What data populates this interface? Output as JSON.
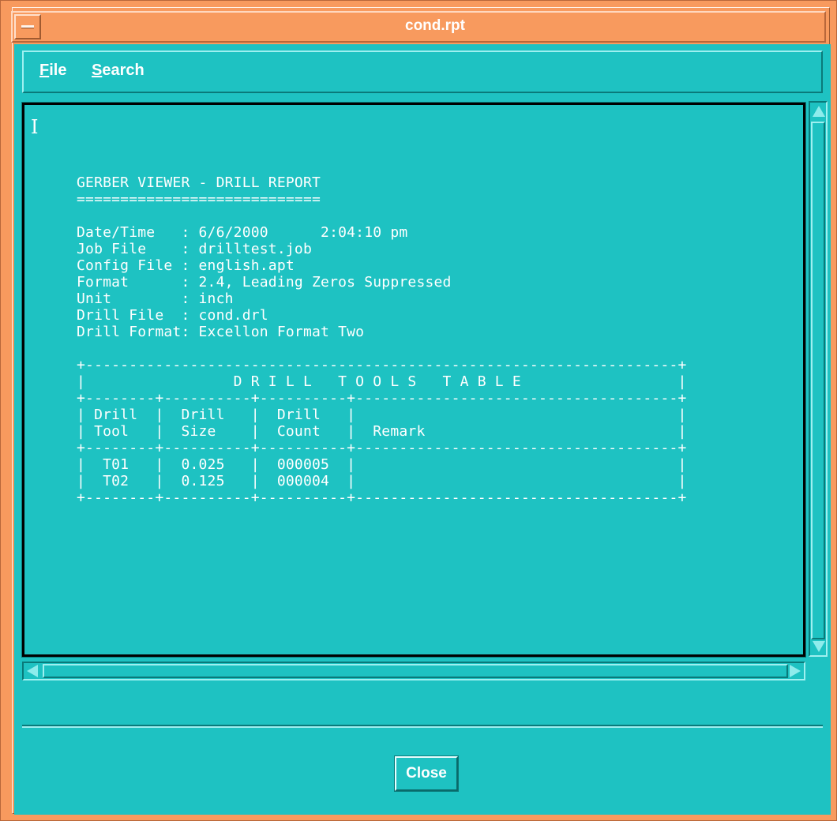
{
  "window": {
    "title": "cond.rpt"
  },
  "menubar": {
    "items": [
      {
        "mnemonic": "F",
        "rest": "ile"
      },
      {
        "mnemonic": "S",
        "rest": "earch"
      }
    ]
  },
  "report": {
    "lines": [
      "GERBER VIEWER - DRILL REPORT",
      "============================",
      "",
      "Date/Time   : 6/6/2000      2:04:10 pm",
      "Job File    : drilltest.job",
      "Config File : english.apt",
      "Format      : 2.4, Leading Zeros Suppressed",
      "Unit        : inch",
      "Drill File  : cond.drl",
      "Drill Format: Excellon Format Two",
      "",
      "+--------------------------------------------------------------------+",
      "|                 D R I L L   T O O L S   T A B L E                  |",
      "+--------+----------+----------+-------------------------------------+",
      "| Drill  |  Drill   |  Drill   |                                     |",
      "| Tool   |  Size    |  Count   |  Remark                             |",
      "+--------+----------+----------+-------------------------------------+",
      "|  T01   |  0.025   |  000005  |                                     |",
      "|  T02   |  0.125   |  000004  |                                     |",
      "+--------+----------+----------+-------------------------------------+"
    ]
  },
  "buttons": {
    "close": "Close"
  },
  "colors": {
    "frame": "#f89a5e",
    "client": "#1ec2c2",
    "text": "#ffffff"
  }
}
